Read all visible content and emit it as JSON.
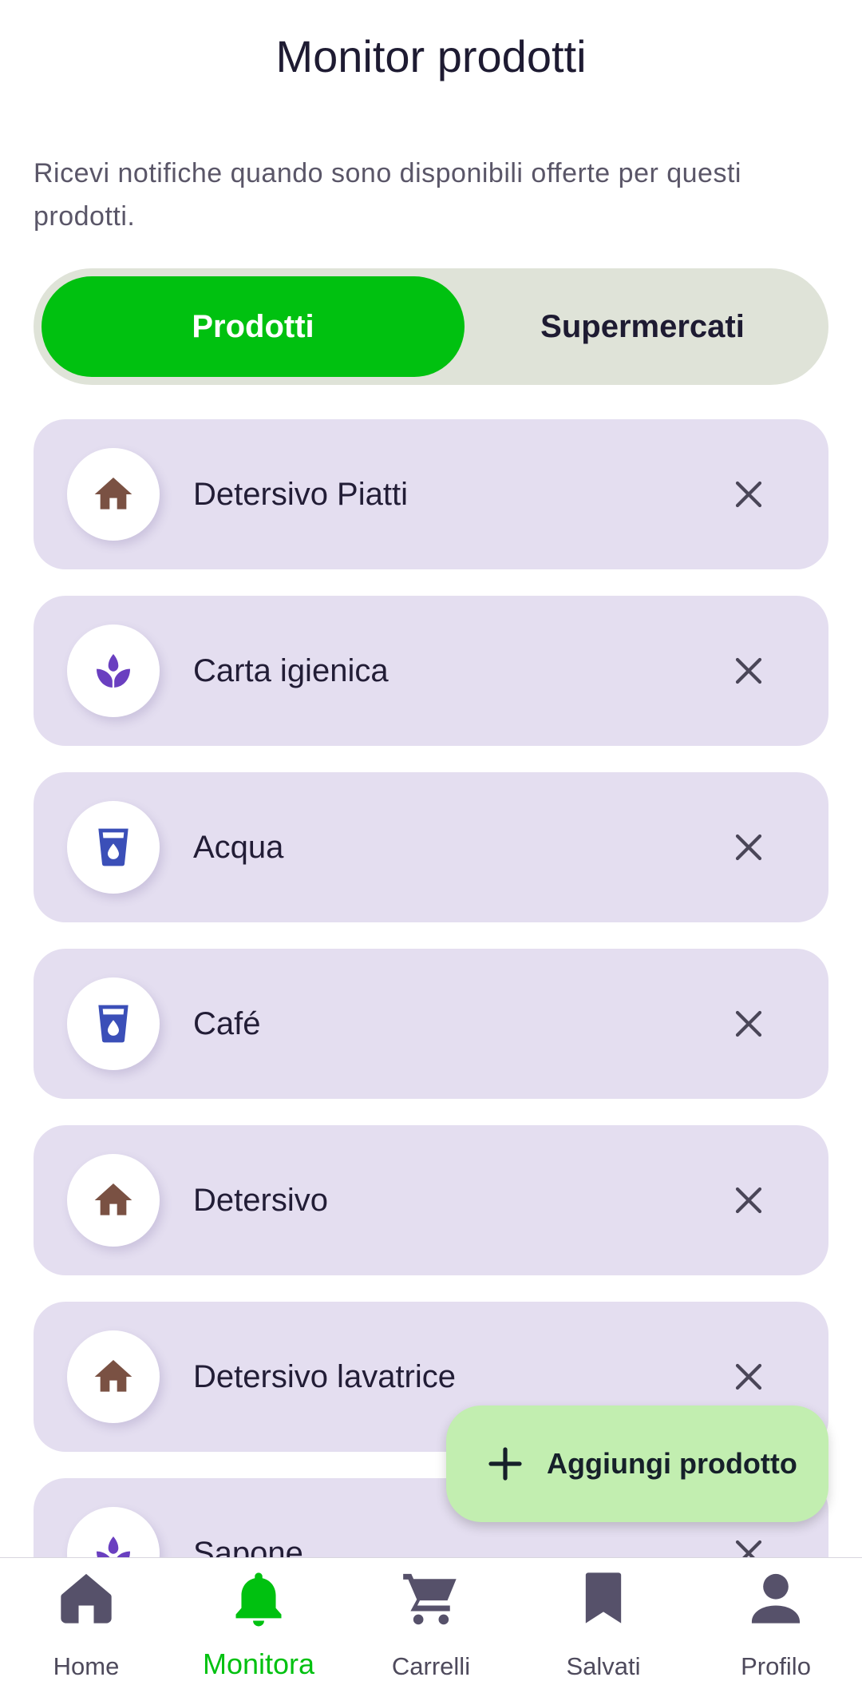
{
  "page": {
    "title": "Monitor prodotti",
    "subtitle": "Ricevi notifiche quando sono disponibili offerte per questi prodotti."
  },
  "segments": {
    "products_label": "Prodotti",
    "stores_label": "Supermercati",
    "selected": "Prodotti"
  },
  "products": [
    {
      "name": "Detersivo Piatti",
      "icon": "house-icon",
      "icon_color": "#7a5143"
    },
    {
      "name": "Carta igienica",
      "icon": "lotus-icon",
      "icon_color": "#6a3fc0"
    },
    {
      "name": "Acqua",
      "icon": "water-glass-icon",
      "icon_color": "#3b4fb8"
    },
    {
      "name": "Café",
      "icon": "water-glass-icon",
      "icon_color": "#3b4fb8"
    },
    {
      "name": "Detersivo",
      "icon": "house-icon",
      "icon_color": "#7a5143"
    },
    {
      "name": "Detersivo lavatrice",
      "icon": "house-icon",
      "icon_color": "#7a5143"
    },
    {
      "name": "Sapone",
      "icon": "lotus-icon",
      "icon_color": "#6a3fc0"
    }
  ],
  "fab": {
    "label": "Aggiungi prodotto",
    "icon": "plus-icon"
  },
  "nav": [
    {
      "label": "Home",
      "icon": "home-icon"
    },
    {
      "label": "Monitora",
      "icon": "bell-icon",
      "active": true
    },
    {
      "label": "Carrelli",
      "icon": "cart-icon"
    },
    {
      "label": "Salvati",
      "icon": "bookmark-icon"
    },
    {
      "label": "Profilo",
      "icon": "person-icon"
    }
  ],
  "colors": {
    "accent": "#00c110",
    "card_bg": "#e4def0",
    "fab_bg": "#c2eeb0",
    "segment_bg": "#dfe3d8"
  }
}
